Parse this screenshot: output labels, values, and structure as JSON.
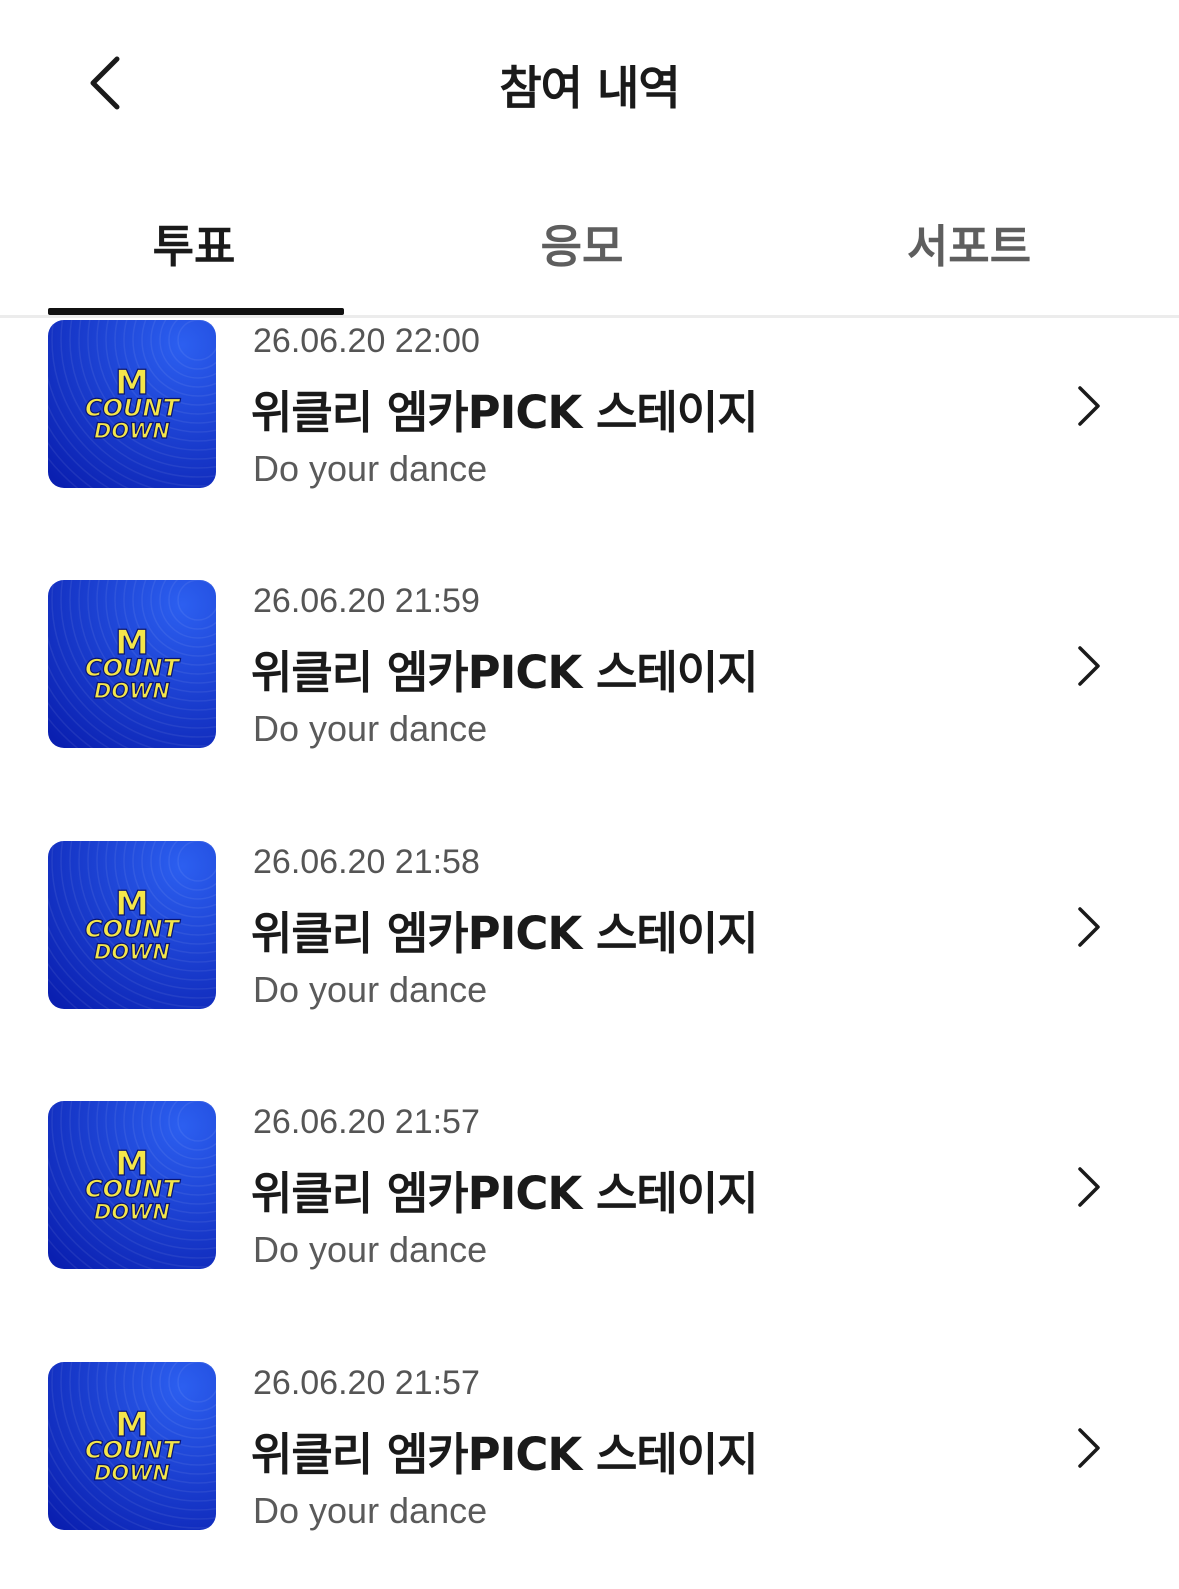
{
  "header": {
    "title": "참여 내역",
    "back_icon": "chevron-left-icon"
  },
  "tabs": [
    {
      "label": "투표",
      "active": true
    },
    {
      "label": "응모",
      "active": false
    },
    {
      "label": "서포트",
      "active": false
    }
  ],
  "thumbnail": {
    "logo_text_top": "M",
    "logo_text_mid": "COUNT",
    "logo_text_bottom": "DOWN",
    "bg_color_light": "#2c5ff0",
    "bg_color_dark": "#0a1fb0",
    "logo_color": "#f4e64a"
  },
  "items": [
    {
      "date": "26.06.20 22:00",
      "title": "위클리 엠카PICK 스테이지",
      "subtitle": "Do your dance"
    },
    {
      "date": "26.06.20 21:59",
      "title": "위클리 엠카PICK 스테이지",
      "subtitle": "Do your dance"
    },
    {
      "date": "26.06.20 21:58",
      "title": "위클리 엠카PICK 스테이지",
      "subtitle": "Do your dance"
    },
    {
      "date": "26.06.20 21:57",
      "title": "위클리 엠카PICK 스테이지",
      "subtitle": "Do your dance"
    },
    {
      "date": "26.06.20 21:57",
      "title": "위클리 엠카PICK 스테이지",
      "subtitle": "Do your dance"
    }
  ]
}
